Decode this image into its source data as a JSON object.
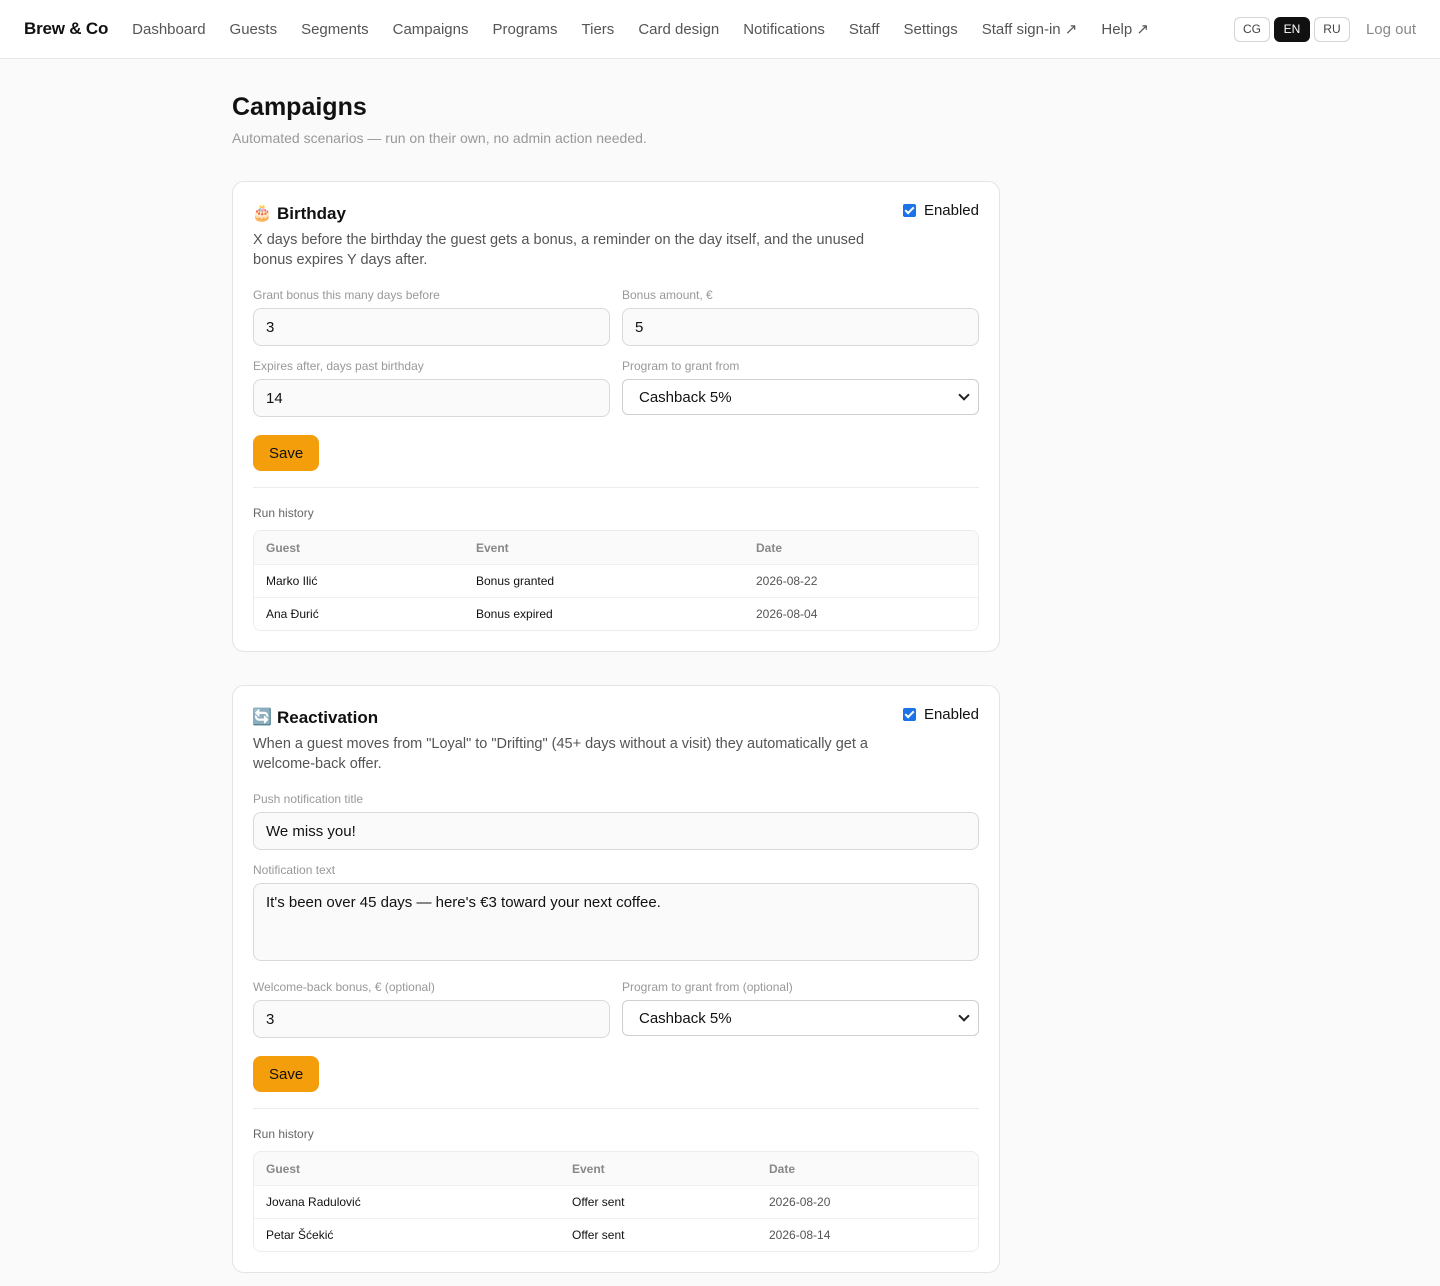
{
  "nav": {
    "brand": "Brew & Co",
    "links": [
      "Dashboard",
      "Guests",
      "Segments",
      "Campaigns",
      "Programs",
      "Tiers",
      "Card design",
      "Notifications",
      "Staff",
      "Settings",
      "Staff sign-in ↗",
      "Help ↗"
    ],
    "languages": [
      "CG",
      "EN",
      "RU"
    ],
    "active_language": "EN",
    "logout": "Log out"
  },
  "page": {
    "title": "Campaigns",
    "subtitle": "Automated scenarios — run on their own, no admin action needed."
  },
  "birthday": {
    "icon": "🎂",
    "title": "Birthday",
    "enabled_label": "Enabled",
    "description": "X days before the birthday the guest gets a bonus, a reminder on the day itself, and the unused bonus expires Y days after.",
    "fields": {
      "days_before_label": "Grant bonus this many days before",
      "days_before_value": "3",
      "amount_label": "Bonus amount, €",
      "amount_value": "5",
      "expires_label": "Expires after, days past birthday",
      "expires_value": "14",
      "program_label": "Program to grant from",
      "program_value": "Cashback 5%"
    },
    "save_label": "Save",
    "history_label": "Run history",
    "history_headers": [
      "Guest",
      "Event",
      "Date"
    ],
    "history_rows": [
      [
        "Marko Ilić",
        "Bonus granted",
        "2026-08-22"
      ],
      [
        "Ana Đurić",
        "Bonus expired",
        "2026-08-04"
      ]
    ]
  },
  "reactivation": {
    "icon": "🔄",
    "title": "Reactivation",
    "enabled_label": "Enabled",
    "description": "When a guest moves from \"Loyal\" to \"Drifting\" (45+ days without a visit) they automatically get a welcome-back offer.",
    "fields": {
      "push_title_label": "Push notification title",
      "push_title_value": "We miss you!",
      "text_label": "Notification text",
      "text_value": "It's been over 45 days — here's €3 toward your next coffee.",
      "bonus_label": "Welcome-back bonus, € (optional)",
      "bonus_value": "3",
      "program_label": "Program to grant from (optional)",
      "program_value": "Cashback 5%"
    },
    "save_label": "Save",
    "history_label": "Run history",
    "history_headers": [
      "Guest",
      "Event",
      "Date"
    ],
    "history_rows": [
      [
        "Jovana Radulović",
        "Offer sent",
        "2026-08-20"
      ],
      [
        "Petar Šćekić",
        "Offer sent",
        "2026-08-14"
      ]
    ]
  },
  "colors": {
    "accent": "#f59e0b",
    "checkbox": "#1a73e8",
    "active_lang": "#111111"
  }
}
